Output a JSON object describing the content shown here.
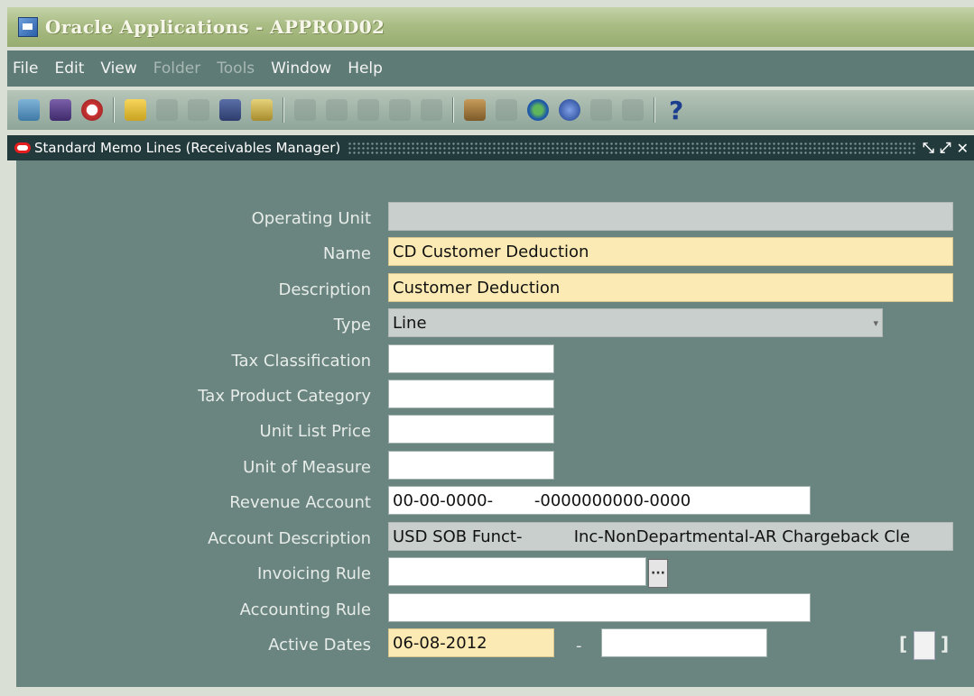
{
  "window": {
    "title": "Oracle Applications - APPROD02"
  },
  "menu": [
    {
      "label": "File",
      "enabled": true
    },
    {
      "label": "Edit",
      "enabled": true
    },
    {
      "label": "View",
      "enabled": true
    },
    {
      "label": "Folder",
      "enabled": false
    },
    {
      "label": "Tools",
      "enabled": false
    },
    {
      "label": "Window",
      "enabled": true
    },
    {
      "label": "Help",
      "enabled": true
    }
  ],
  "toolbar": {
    "help_label": "?"
  },
  "form_window": {
    "title": "Standard Memo Lines (Receivables Manager)"
  },
  "fields": {
    "operating_unit": {
      "label": "Operating Unit",
      "value": ""
    },
    "name": {
      "label": "Name",
      "value": "CD Customer Deduction"
    },
    "description": {
      "label": "Description",
      "value": "Customer Deduction"
    },
    "type": {
      "label": "Type",
      "value": "Line"
    },
    "tax_classification": {
      "label": "Tax Classification",
      "value": ""
    },
    "tax_product_category": {
      "label": "Tax Product Category",
      "value": ""
    },
    "unit_list_price": {
      "label": "Unit List Price",
      "value": ""
    },
    "unit_of_measure": {
      "label": "Unit of Measure",
      "value": ""
    },
    "revenue_account": {
      "label": "Revenue Account",
      "value": "00-00-0000-        -0000000000-0000"
    },
    "account_description": {
      "label": "Account Description",
      "value": "USD SOB Funct-          Inc-NonDepartmental-AR Chargeback Cle"
    },
    "invoicing_rule": {
      "label": "Invoicing Rule",
      "value": ""
    },
    "accounting_rule": {
      "label": "Accounting Rule",
      "value": ""
    },
    "active_dates": {
      "label": "Active Dates",
      "from": "06-08-2012",
      "separator": "-",
      "to": ""
    }
  },
  "flexfield": {
    "open": "[",
    "close": "]"
  },
  "colors": {
    "required_field": "#fbeab3",
    "readonly_field": "#c9cfcc",
    "form_background": "#6a8480",
    "title_bar": "#a9bc84"
  }
}
